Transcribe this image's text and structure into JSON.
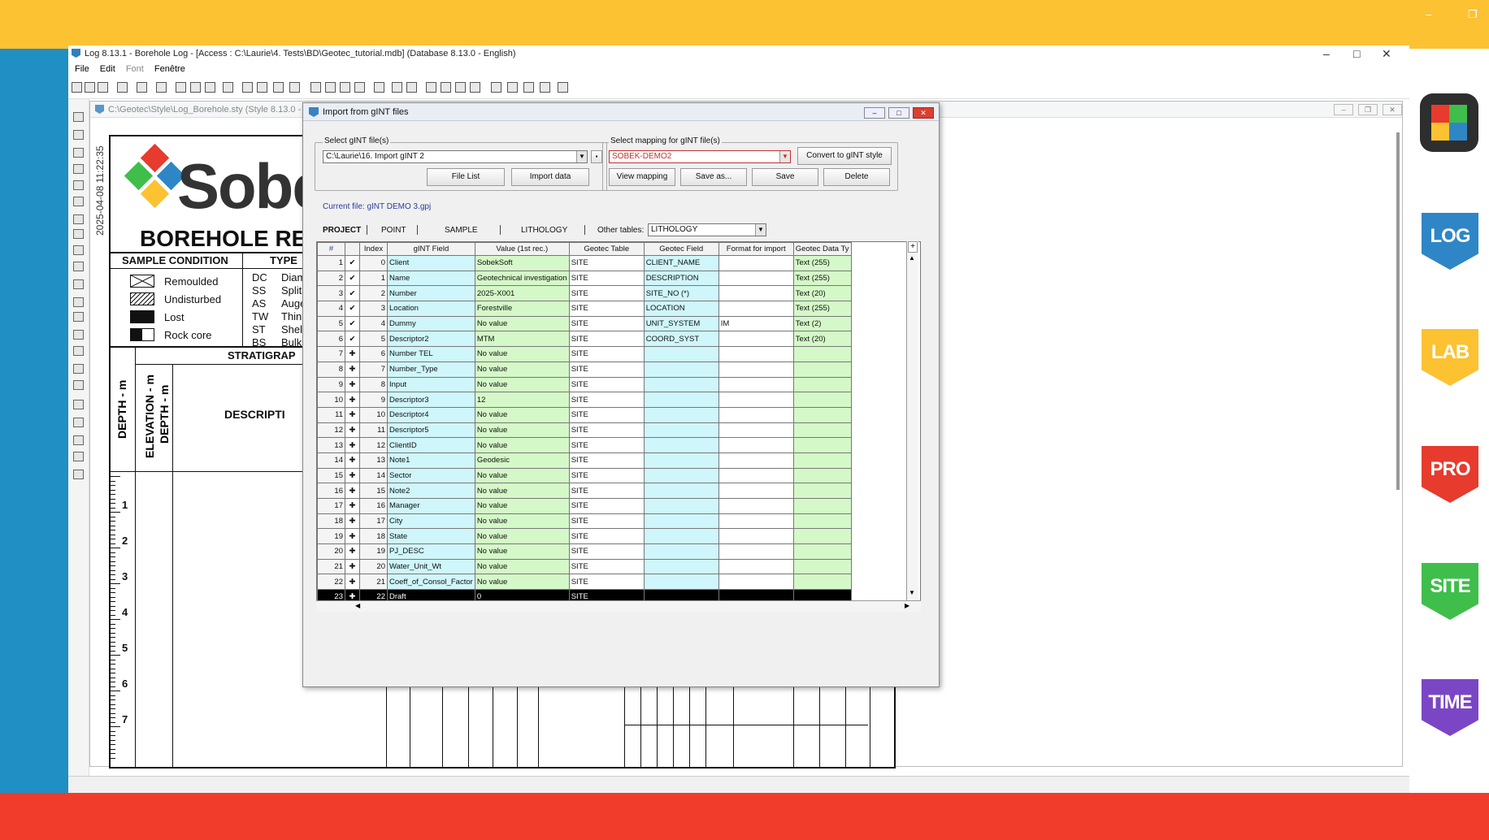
{
  "app": {
    "title": "Log 8.13.1 - Borehole Log - [Access : C:\\Laurie\\4. Tests\\BD\\Geotec_tutorial.mdb] (Database 8.13.0 - English)",
    "menu": [
      "File",
      "Edit",
      "Font",
      "Fenêtre"
    ],
    "mdi_title": "C:\\Geotec\\Style\\Log_Borehole.sty (Style 8.13.0 - Fren",
    "window_controls": {
      "minimize": "–",
      "maximize": "□",
      "close": "✕"
    }
  },
  "side_badges": [
    "LOG",
    "LAB",
    "PRO",
    "SITE",
    "TIME"
  ],
  "badge_colors": {
    "LOG": "#2f86c6",
    "LAB": "#fcc232",
    "PRO": "#e63b2d",
    "SITE": "#3fbe4b",
    "TIME": "#7b46c6"
  },
  "borehole": {
    "datestamp": "2025-04-08 11:22:35",
    "brand": "Sobe",
    "title": "BOREHOLE RE",
    "sample_condition_header": "SAMPLE CONDITION",
    "type_header": "TYPE",
    "conditions": [
      "Remoulded",
      "Undisturbed",
      "Lost",
      "Rock core"
    ],
    "types": [
      {
        "code": "DC",
        "label": "Diam"
      },
      {
        "code": "SS",
        "label": "Split"
      },
      {
        "code": "AS",
        "label": "Auge"
      },
      {
        "code": "TW",
        "label": "Thin"
      },
      {
        "code": "ST",
        "label": "Shelb"
      },
      {
        "code": "BS",
        "label": "Bulk"
      }
    ],
    "stratigraphy_header": "STRATIGRAP",
    "depth_label": "DEPTH - m",
    "elevation_label": "ELEVATION - m",
    "depth_label2": "DEPTH - m",
    "description_label": "DESCRIPTI",
    "depth_ticks": [
      "1",
      "2",
      "3",
      "4",
      "5",
      "6",
      "7"
    ]
  },
  "dialog": {
    "title": "Import from gINT files",
    "select_files_label": "Select gINT file(s)",
    "file_path": "C:\\Laurie\\16. Import gINT 2",
    "file_list_btn": "File List",
    "import_data_btn": "Import data",
    "select_mapping_label": "Select mapping for gINT file(s)",
    "mapping_value": "SOBEK-DEMO2",
    "convert_btn": "Convert to gINT style",
    "view_mapping_btn": "View mapping",
    "save_as_btn": "Save as...",
    "save_btn": "Save",
    "delete_btn": "Delete",
    "current_file": "Current file: gINT DEMO 3.gpj",
    "tabs": [
      "PROJECT",
      "POINT",
      "SAMPLE",
      "LITHOLOGY"
    ],
    "other_tables_label": "Other tables:",
    "other_tables_value": "LITHOLOGY",
    "columns": [
      "#",
      "",
      "Index",
      "gINT Field",
      "Value (1st rec.)",
      "Geotec Table",
      "Geotec Field",
      "Format for import",
      "Geotec Data Ty"
    ],
    "rows": [
      {
        "n": "1",
        "s": "check",
        "i": "0",
        "f": "Client",
        "v": "SobekSoft",
        "t": "SITE",
        "gf": "CLIENT_NAME",
        "fmt": "",
        "dt": "Text (255)"
      },
      {
        "n": "2",
        "s": "check",
        "i": "1",
        "f": "Name",
        "v": "Geotechnical investigation",
        "t": "SITE",
        "gf": "DESCRIPTION",
        "fmt": "",
        "dt": "Text (255)"
      },
      {
        "n": "3",
        "s": "check",
        "i": "2",
        "f": "Number",
        "v": "2025-X001",
        "t": "SITE",
        "gf": "SITE_NO (*)",
        "fmt": "",
        "dt": "Text (20)"
      },
      {
        "n": "4",
        "s": "check",
        "i": "3",
        "f": "Location",
        "v": "Forestville",
        "t": "SITE",
        "gf": "LOCATION",
        "fmt": "",
        "dt": "Text (255)"
      },
      {
        "n": "5",
        "s": "check",
        "i": "4",
        "f": "Dummy",
        "v": "No value",
        "t": "SITE",
        "gf": "UNIT_SYSTEM",
        "fmt": "IM",
        "dt": "Text (2)"
      },
      {
        "n": "6",
        "s": "check",
        "i": "5",
        "f": "Descriptor2",
        "v": "MTM",
        "t": "SITE",
        "gf": "COORD_SYST",
        "fmt": "",
        "dt": "Text (20)"
      },
      {
        "n": "7",
        "s": "plus",
        "i": "6",
        "f": "Number TEL",
        "v": "No value",
        "t": "SITE",
        "gf": "",
        "fmt": "",
        "dt": ""
      },
      {
        "n": "8",
        "s": "plus",
        "i": "7",
        "f": "Number_Type",
        "v": "No value",
        "t": "SITE",
        "gf": "",
        "fmt": "",
        "dt": ""
      },
      {
        "n": "9",
        "s": "plus",
        "i": "8",
        "f": "Input",
        "v": "No value",
        "t": "SITE",
        "gf": "",
        "fmt": "",
        "dt": ""
      },
      {
        "n": "10",
        "s": "plus",
        "i": "9",
        "f": "Descriptor3",
        "v": "12",
        "t": "SITE",
        "gf": "",
        "fmt": "",
        "dt": ""
      },
      {
        "n": "11",
        "s": "plus",
        "i": "10",
        "f": "Descriptor4",
        "v": "No value",
        "t": "SITE",
        "gf": "",
        "fmt": "",
        "dt": ""
      },
      {
        "n": "12",
        "s": "plus",
        "i": "11",
        "f": "Descriptor5",
        "v": "No value",
        "t": "SITE",
        "gf": "",
        "fmt": "",
        "dt": ""
      },
      {
        "n": "13",
        "s": "plus",
        "i": "12",
        "f": "ClientID",
        "v": "No value",
        "t": "SITE",
        "gf": "",
        "fmt": "",
        "dt": ""
      },
      {
        "n": "14",
        "s": "plus",
        "i": "13",
        "f": "Note1",
        "v": "Geodesic",
        "t": "SITE",
        "gf": "",
        "fmt": "",
        "dt": ""
      },
      {
        "n": "15",
        "s": "plus",
        "i": "14",
        "f": "Sector",
        "v": "No value",
        "t": "SITE",
        "gf": "",
        "fmt": "",
        "dt": ""
      },
      {
        "n": "16",
        "s": "plus",
        "i": "15",
        "f": "Note2",
        "v": "No value",
        "t": "SITE",
        "gf": "",
        "fmt": "",
        "dt": ""
      },
      {
        "n": "17",
        "s": "plus",
        "i": "16",
        "f": "Manager",
        "v": "No value",
        "t": "SITE",
        "gf": "",
        "fmt": "",
        "dt": ""
      },
      {
        "n": "18",
        "s": "plus",
        "i": "17",
        "f": "City",
        "v": "No value",
        "t": "SITE",
        "gf": "",
        "fmt": "",
        "dt": ""
      },
      {
        "n": "19",
        "s": "plus",
        "i": "18",
        "f": "State",
        "v": "No value",
        "t": "SITE",
        "gf": "",
        "fmt": "",
        "dt": ""
      },
      {
        "n": "20",
        "s": "plus",
        "i": "19",
        "f": "PJ_DESC",
        "v": "No value",
        "t": "SITE",
        "gf": "",
        "fmt": "",
        "dt": ""
      },
      {
        "n": "21",
        "s": "plus",
        "i": "20",
        "f": "Water_Unit_Wt",
        "v": "No value",
        "t": "SITE",
        "gf": "",
        "fmt": "",
        "dt": ""
      },
      {
        "n": "22",
        "s": "plus",
        "i": "21",
        "f": "Coeff_of_Consol_Factor",
        "v": "No value",
        "t": "SITE",
        "gf": "",
        "fmt": "",
        "dt": ""
      },
      {
        "n": "23",
        "s": "plus",
        "i": "22",
        "f": "Draft",
        "v": "0",
        "t": "SITE",
        "gf": "",
        "fmt": "",
        "dt": ""
      }
    ],
    "selected_row": "23"
  },
  "icons": {
    "check": "✔",
    "plus": "✚",
    "add_column": "+"
  }
}
